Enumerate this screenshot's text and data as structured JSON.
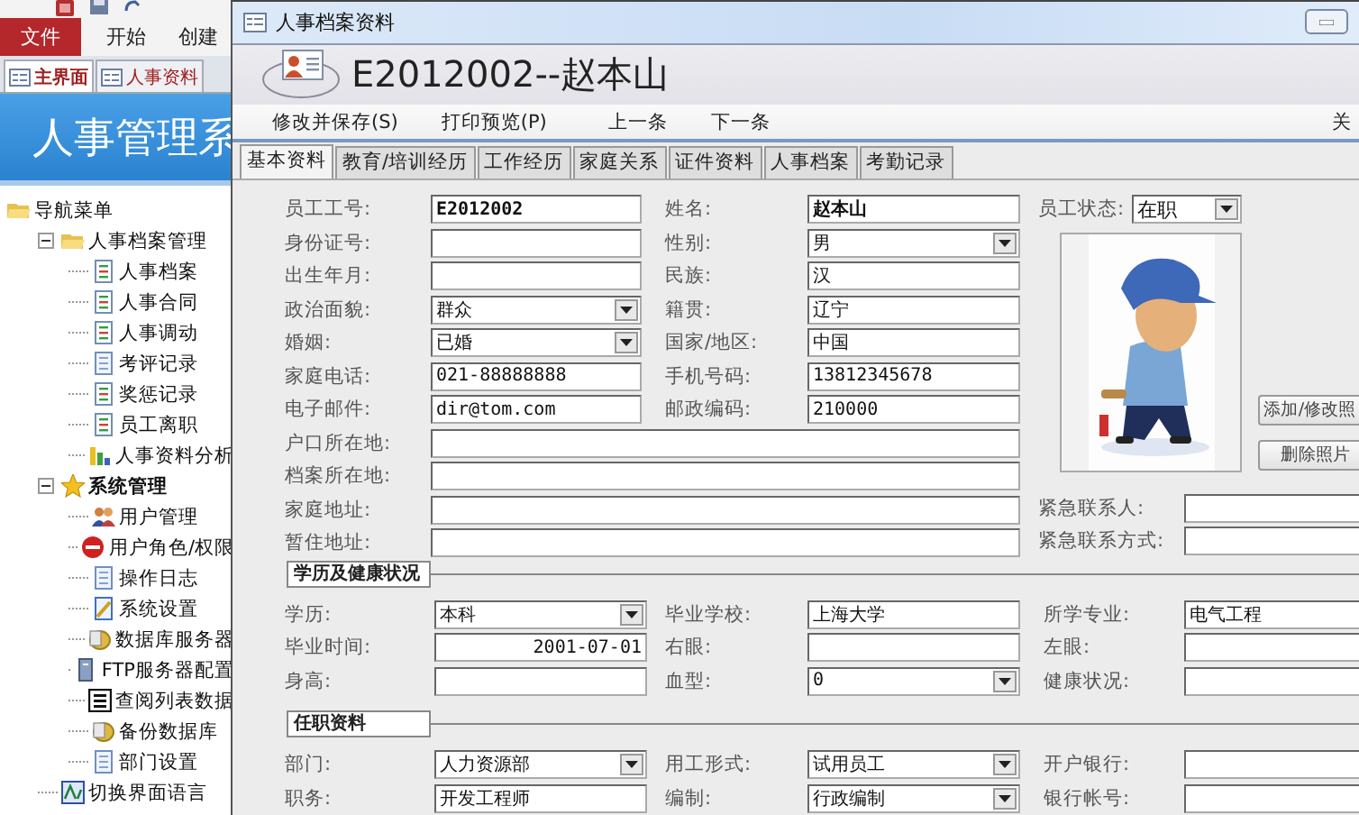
{
  "app": {
    "ribbon_tabs": [
      {
        "label": "文件",
        "selected": true
      },
      {
        "label": "开始",
        "selected": false
      },
      {
        "label": "创建",
        "selected": false
      }
    ],
    "doc_tabs": [
      {
        "label": "主界面",
        "selected": true
      },
      {
        "label": "人事资料",
        "selected": false
      }
    ],
    "banner": "人事管理系",
    "nav": [
      {
        "label": "导航菜单",
        "kind": "folder",
        "children": [
          {
            "label": "人事档案管理",
            "kind": "folder",
            "expanded": true,
            "children": [
              {
                "label": "人事档案",
                "kind": "doc"
              },
              {
                "label": "人事合同",
                "kind": "doc"
              },
              {
                "label": "人事调动",
                "kind": "doc"
              },
              {
                "label": "考评记录",
                "kind": "page"
              },
              {
                "label": "奖惩记录",
                "kind": "doc"
              },
              {
                "label": "员工离职",
                "kind": "doc"
              },
              {
                "label": "人事资料分析",
                "kind": "chart"
              }
            ]
          },
          {
            "label": "系统管理",
            "kind": "star",
            "expanded": true,
            "children": [
              {
                "label": "用户管理",
                "kind": "users"
              },
              {
                "label": "用户角色/权限",
                "kind": "stop"
              },
              {
                "label": "操作日志",
                "kind": "page"
              },
              {
                "label": "系统设置",
                "kind": "settings"
              },
              {
                "label": "数据库服务器",
                "kind": "database"
              },
              {
                "label": "FTP服务器配置",
                "kind": "server"
              },
              {
                "label": "查阅列表数据",
                "kind": "list"
              },
              {
                "label": "备份数据库",
                "kind": "database"
              },
              {
                "label": "部门设置",
                "kind": "page"
              }
            ]
          },
          {
            "label": "切换界面语言",
            "kind": "language"
          }
        ]
      }
    ]
  },
  "dialog": {
    "title": "人事档案资料",
    "record_title": "E2012002--赵本山",
    "toolbar": [
      "修改并保存(S)",
      "打印预览(P)",
      "上一条",
      "下一条"
    ],
    "close": "关",
    "tabs": [
      {
        "label": "基本资料",
        "selected": true
      },
      {
        "label": "教育/培训经历",
        "selected": false
      },
      {
        "label": "工作经历",
        "selected": false
      },
      {
        "label": "家庭关系",
        "selected": false
      },
      {
        "label": "证件资料",
        "selected": false
      },
      {
        "label": "人事档案",
        "selected": false
      },
      {
        "label": "考勤记录",
        "selected": false
      }
    ],
    "basic_rows": [
      {
        "kind": "pair",
        "cells": [
          {
            "label": "员工工号:",
            "value": "E2012002",
            "kind": "text",
            "bold": true
          },
          {
            "label": "姓名:",
            "value": "赵本山",
            "kind": "text",
            "bold": true
          }
        ]
      },
      {
        "kind": "pair",
        "cells": [
          {
            "label": "身份证号:",
            "kind": "text"
          },
          {
            "label": "性别:",
            "value": "男",
            "kind": "select"
          }
        ]
      },
      {
        "kind": "pair",
        "cells": [
          {
            "label": "出生年月:",
            "kind": "text"
          },
          {
            "label": "民族:",
            "value": "汉",
            "kind": "text"
          }
        ]
      },
      {
        "kind": "pair",
        "cells": [
          {
            "label": "政治面貌:",
            "value": "群众",
            "kind": "select"
          },
          {
            "label": "籍贯:",
            "value": "辽宁",
            "kind": "text"
          }
        ]
      },
      {
        "kind": "pair",
        "cells": [
          {
            "label": "婚姻:",
            "value": "已婚",
            "kind": "select"
          },
          {
            "label": "国家/地区:",
            "value": "中国",
            "kind": "text"
          }
        ]
      },
      {
        "kind": "pair",
        "cells": [
          {
            "label": "家庭电话:",
            "value": "021-88888888",
            "kind": "text"
          },
          {
            "label": "手机号码:",
            "value": "13812345678",
            "kind": "text"
          }
        ]
      },
      {
        "kind": "pair",
        "cells": [
          {
            "label": "电子邮件:",
            "value": "dir@tom.com",
            "kind": "text"
          },
          {
            "label": "邮政编码:",
            "value": "210000",
            "kind": "text"
          }
        ]
      },
      {
        "kind": "wide",
        "cells": [
          {
            "label": "户口所在地:",
            "kind": "text"
          }
        ]
      },
      {
        "kind": "wide",
        "cells": [
          {
            "label": "档案所在地:",
            "kind": "text"
          }
        ]
      },
      {
        "kind": "wide",
        "cells": [
          {
            "label": "家庭地址:",
            "kind": "text"
          }
        ]
      },
      {
        "kind": "wide",
        "cells": [
          {
            "label": "暂住地址:",
            "kind": "text"
          }
        ]
      }
    ],
    "status": {
      "label": "员工状态:",
      "value": "在职",
      "kind": "select"
    },
    "photo": {
      "kind": "picture"
    },
    "photo_buttons": [
      "添加/修改照",
      "删除照片"
    ],
    "emergency": [
      {
        "label": "紧急联系人:"
      },
      {
        "label": "紧急联系方式:"
      }
    ],
    "sections": [
      {
        "title": "学历及健康状况",
        "rows": [
          {
            "cells": [
              {
                "label": "学历:",
                "value": "本科",
                "kind": "select"
              },
              {
                "label": "毕业学校:",
                "value": "上海大学",
                "kind": "text"
              },
              {
                "label": "所学专业:",
                "value": "电气工程",
                "kind": "text"
              }
            ]
          },
          {
            "cells": [
              {
                "label": "毕业时间:",
                "value": "2001-07-01",
                "kind": "date"
              },
              {
                "label": "右眼:",
                "kind": "text"
              },
              {
                "label": "左眼:",
                "kind": "text"
              }
            ]
          },
          {
            "cells": [
              {
                "label": "身高:",
                "kind": "text"
              },
              {
                "label": "血型:",
                "value": "0",
                "kind": "select"
              },
              {
                "label": "健康状况:",
                "kind": "text"
              }
            ]
          }
        ]
      },
      {
        "title": "任职资料",
        "rows": [
          {
            "cells": [
              {
                "label": "部门:",
                "value": "人力资源部",
                "kind": "select"
              },
              {
                "label": "用工形式:",
                "value": "试用员工",
                "kind": "select"
              },
              {
                "label": "开户银行:",
                "kind": "text"
              }
            ]
          },
          {
            "cells": [
              {
                "label": "职务:",
                "value": "开发工程师",
                "kind": "text"
              },
              {
                "label": "编制:",
                "value": "行政编制",
                "kind": "select"
              },
              {
                "label": "银行帐号:",
                "kind": "text"
              }
            ]
          }
        ]
      }
    ]
  }
}
